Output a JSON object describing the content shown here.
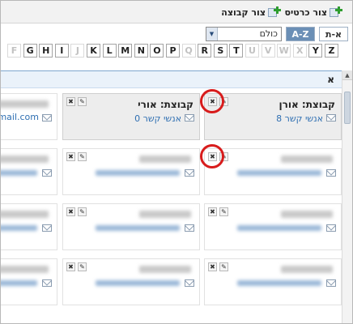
{
  "toolbar": {
    "new_card_label": "צור כרטיס",
    "new_group_label": "צור קבוצה"
  },
  "filter": {
    "sort_heb_label": "א-ת",
    "sort_az_label": "A-Z",
    "select_value": "כולם"
  },
  "letters": [
    {
      "label": "F",
      "enabled": false
    },
    {
      "label": "G",
      "enabled": true
    },
    {
      "label": "H",
      "enabled": true
    },
    {
      "label": "I",
      "enabled": true
    },
    {
      "label": "J",
      "enabled": false
    },
    {
      "label": "K",
      "enabled": true
    },
    {
      "label": "L",
      "enabled": true
    },
    {
      "label": "M",
      "enabled": true
    },
    {
      "label": "N",
      "enabled": true
    },
    {
      "label": "O",
      "enabled": true
    },
    {
      "label": "P",
      "enabled": true
    },
    {
      "label": "Q",
      "enabled": false
    },
    {
      "label": "R",
      "enabled": true
    },
    {
      "label": "S",
      "enabled": true
    },
    {
      "label": "T",
      "enabled": true
    },
    {
      "label": "U",
      "enabled": false
    },
    {
      "label": "V",
      "enabled": false
    },
    {
      "label": "W",
      "enabled": false
    },
    {
      "label": "X",
      "enabled": false
    },
    {
      "label": "Y",
      "enabled": true
    },
    {
      "label": "Z",
      "enabled": true
    }
  ],
  "section": {
    "title": "א"
  },
  "groups": [
    {
      "name": "קבוצת: אורן",
      "contacts": "8 אנשי קשר"
    },
    {
      "name": "קבוצת: אורי",
      "contacts": "0 אנשי קשר"
    }
  ],
  "partial_email": "mail.com",
  "colors": {
    "accent": "#6b8fb6",
    "link": "#2f6fb2",
    "highlight": "#d81c1c",
    "section_bg": "#eaf2fa"
  },
  "icons": {
    "delete": "✖",
    "edit": "✎"
  }
}
